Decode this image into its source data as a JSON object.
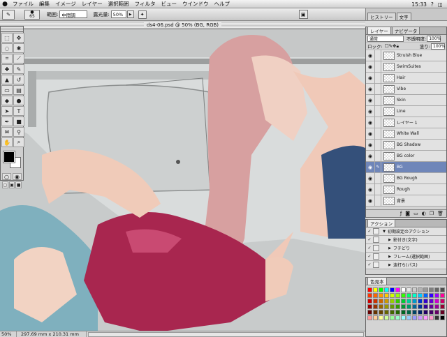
{
  "menubar": {
    "apple": "",
    "items": [
      "ファイル",
      "編集",
      "イメージ",
      "レイヤー",
      "選択範囲",
      "フィルタ",
      "ビュー",
      "ウインドウ",
      "ヘルプ"
    ],
    "clock": "15:33"
  },
  "options": {
    "brush_size": "65",
    "range_label": "範囲:",
    "range_value": "中間調",
    "exposure_label": "露光量:",
    "exposure_value": "50%"
  },
  "top_tabs": [
    "ヒストリー",
    "文字"
  ],
  "document": {
    "title": "ds4-06.psd @ 50% (BG, RGB)",
    "zoom": "50%",
    "size": "297.69 mm x 210.31 mm"
  },
  "layers_panel": {
    "tabs": [
      "レイヤー",
      "ナビゲータ"
    ],
    "blend_mode": "通常",
    "opacity_label": "不透明度:",
    "opacity_value": "100%",
    "lock_label": "ロック:",
    "fill_label": "塗り:",
    "fill_value": "100%",
    "layers": [
      "Struish Blue",
      "SwimSuites",
      "Hair",
      "Vibe",
      "Skin",
      "Line",
      "レイヤー 1",
      "White Wall",
      "BG Shadow",
      "BG color",
      "BG",
      "BG Rough",
      "Rough",
      "背景"
    ],
    "active_layer": "BG"
  },
  "actions_panel": {
    "tab": "アクション",
    "items": [
      "初期設定のアクション",
      "影付き(文字)",
      "フチどり",
      "フレーム(選択範囲)",
      "波打ち(パス)"
    ]
  },
  "swatches_panel": {
    "tab": "色見本",
    "colors": [
      "#ff0000",
      "#ffff00",
      "#00ff00",
      "#00ffff",
      "#0000ff",
      "#ff00ff",
      "#ffffff",
      "#e6e6e6",
      "#cccccc",
      "#b3b3b3",
      "#999999",
      "#808080",
      "#666666",
      "#4d4d4d",
      "#ff3300",
      "#ff6600",
      "#ff9900",
      "#ffcc00",
      "#ccff00",
      "#99ff00",
      "#33ff00",
      "#00ff66",
      "#00ffcc",
      "#00ccff",
      "#0066ff",
      "#3300ff",
      "#9900ff",
      "#ff0099",
      "#cc0000",
      "#cc3300",
      "#cc6600",
      "#cc9900",
      "#99cc00",
      "#33cc00",
      "#00cc33",
      "#00cc99",
      "#0099cc",
      "#0033cc",
      "#3300cc",
      "#6600cc",
      "#cc00cc",
      "#cc0066",
      "#990000",
      "#993300",
      "#996600",
      "#999900",
      "#669900",
      "#339900",
      "#009933",
      "#009966",
      "#006699",
      "#003399",
      "#330099",
      "#660099",
      "#990099",
      "#990033",
      "#660000",
      "#663300",
      "#664400",
      "#666600",
      "#446600",
      "#226600",
      "#006622",
      "#006644",
      "#004466",
      "#002266",
      "#220066",
      "#440066",
      "#660066",
      "#660022",
      "#ff9999",
      "#ffcc99",
      "#ffff99",
      "#ccff99",
      "#99ff99",
      "#99ffcc",
      "#99ffff",
      "#99ccff",
      "#9999ff",
      "#cc99ff",
      "#ff99ff",
      "#ff99cc",
      "#333333",
      "#000000"
    ]
  }
}
